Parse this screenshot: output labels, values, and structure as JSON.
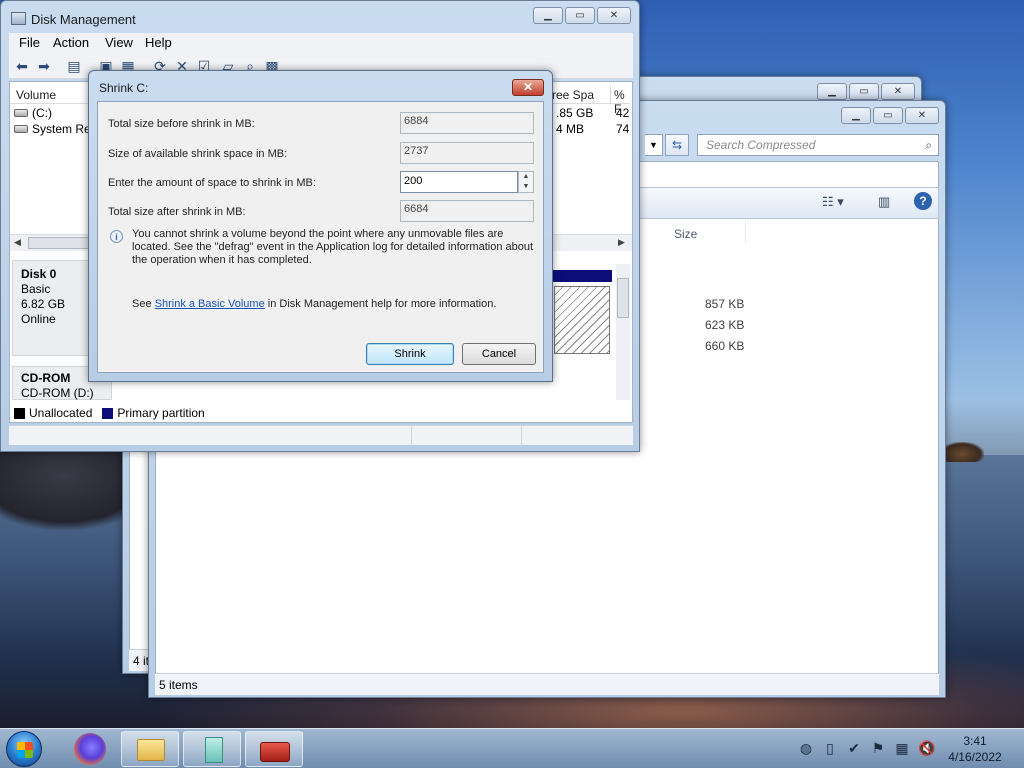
{
  "diskmgmt": {
    "title": "Disk Management",
    "menu": [
      "File",
      "Action",
      "View",
      "Help"
    ],
    "volume_header": {
      "volume": "Volume",
      "free_space": "ree Spa",
      "pct": "% F"
    },
    "volumes": [
      {
        "name": "(C:)",
        "free": ".85 GB",
        "pct": "42"
      },
      {
        "name": "System Res",
        "free": "4 MB",
        "pct": "74"
      }
    ],
    "disk0": {
      "name": "Disk 0",
      "type": "Basic",
      "size": "6.82 GB",
      "status": "Online"
    },
    "cdrom": {
      "name": "CD-ROM",
      "drive": "CD-ROM (D:)"
    },
    "legend": {
      "unallocated": "Unallocated",
      "primary": "Primary partition"
    }
  },
  "shrink_dialog": {
    "title": "Shrink C:",
    "fields": {
      "total_before_label": "Total size before shrink in MB:",
      "total_before_value": "6884",
      "available_label": "Size of available shrink space in MB:",
      "available_value": "2737",
      "amount_label": "Enter the amount of space to shrink in MB:",
      "amount_value": "200",
      "total_after_label": "Total size after shrink in MB:",
      "total_after_value": "6684"
    },
    "info_text": "You cannot shrink a volume beyond the point where any unmovable files are located. See the \"defrag\" event in the Application log for detailed information about the operation when it has completed.",
    "see_prefix": "See ",
    "see_link": "Shrink a Basic Volume",
    "see_suffix": " in Disk Management help for more information.",
    "shrink_button": "Shrink",
    "cancel_button": "Cancel"
  },
  "explorer": {
    "search_placeholder": "Search Compressed",
    "column_size": "Size",
    "files": [
      {
        "size": "857 KB"
      },
      {
        "size": "623 KB"
      },
      {
        "size": "660 KB"
      }
    ],
    "status_front": "5 items",
    "status_back": "4 it"
  },
  "taskbar": {
    "time": "3:41",
    "date": "4/16/2022"
  },
  "colors": {
    "primary_partition": "#0d0d7a",
    "unallocated": "#000000",
    "dialog_close": "#c0402c",
    "link": "#1a55b8"
  }
}
